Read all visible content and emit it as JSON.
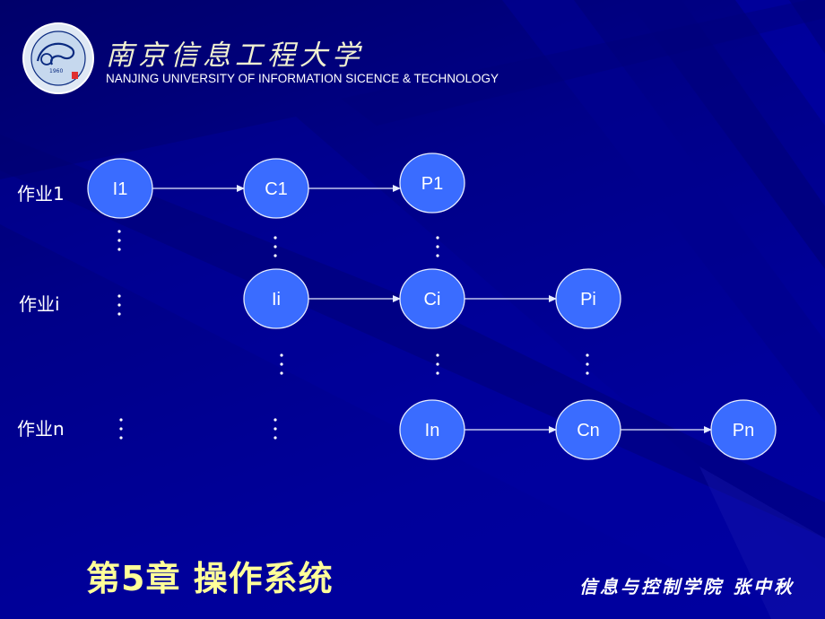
{
  "header": {
    "university_name_cn": "南京信息工程大学",
    "university_name_en": "NANJING UNIVERSITY OF INFORMATION SICENCE & TECHNOLOGY",
    "logo": "university-seal-icon"
  },
  "diagram": {
    "rows": [
      {
        "label": "作业1",
        "nodes": [
          "I1",
          "C1",
          "P1"
        ]
      },
      {
        "label": "作业i",
        "nodes": [
          "Ii",
          "Ci",
          "Pi"
        ]
      },
      {
        "label": "作业n",
        "nodes": [
          "In",
          "Cn",
          "Pn"
        ]
      }
    ],
    "ellipsis": "⋮",
    "colors": {
      "node_fill": "#3a6cff",
      "node_stroke": "#e6ecff",
      "arrow": "#e6ecff",
      "background": "#000090"
    }
  },
  "footer": {
    "chapter_title": "第5章  操作系统",
    "author": "信息与控制学院 张中秋",
    "title_color": "#ffff99"
  }
}
